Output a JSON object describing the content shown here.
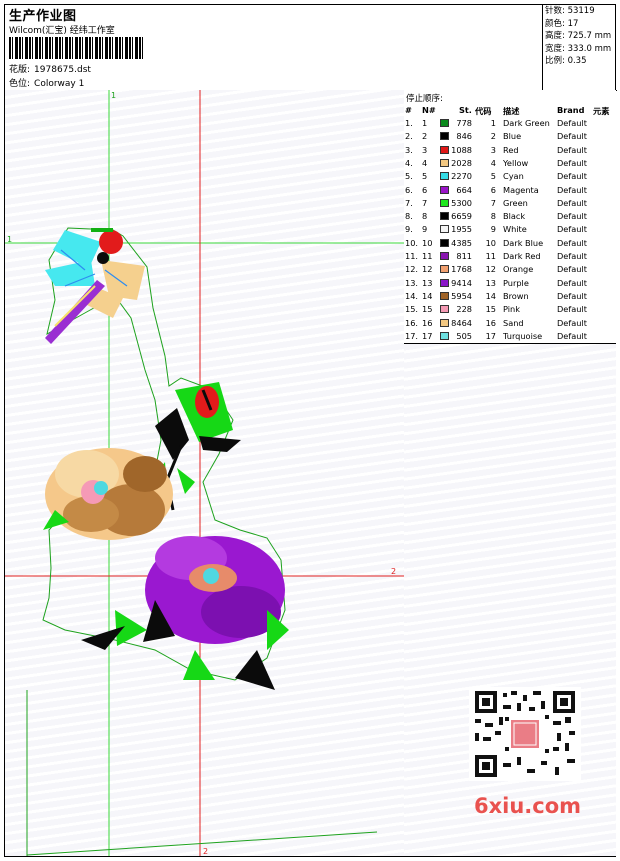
{
  "header": {
    "title": "生产作业图",
    "subtitle": "Wilcom(汇宝) 经纬工作室",
    "design_label": "花版:",
    "design_value": "1978675.dst",
    "colorway_label": "色位:",
    "colorway_value": "Colorway 1"
  },
  "stats": {
    "stitches": "针数: 53119",
    "colors": "颜色: 17",
    "height": "高度: 725.7 mm",
    "width": "宽度: 333.0 mm",
    "scale": "比例: 0.35"
  },
  "canvas": {
    "guide_v1": "1",
    "guide_h1": "1",
    "guide_v2": "2",
    "guide_h2": "2"
  },
  "table": {
    "caption": "停止顺序:",
    "headers": [
      "#",
      "N#",
      "St.",
      "代码",
      "描述",
      "Brand",
      "元素"
    ],
    "rows": [
      {
        "i": "1.",
        "n": "1",
        "color": "#0a8a1c",
        "st": "778",
        "code": "1",
        "desc": "Dark Green",
        "brand": "Default"
      },
      {
        "i": "2.",
        "n": "2",
        "color": "#000000",
        "st": "846",
        "code": "2",
        "desc": "Blue",
        "brand": "Default"
      },
      {
        "i": "3.",
        "n": "3",
        "color": "#e01818",
        "st": "1088",
        "code": "3",
        "desc": "Red",
        "brand": "Default"
      },
      {
        "i": "4.",
        "n": "4",
        "color": "#f3c882",
        "st": "2028",
        "code": "4",
        "desc": "Yellow",
        "brand": "Default"
      },
      {
        "i": "5.",
        "n": "5",
        "color": "#36dde6",
        "st": "2270",
        "code": "5",
        "desc": "Cyan",
        "brand": "Default"
      },
      {
        "i": "6.",
        "n": "6",
        "color": "#9a14c8",
        "st": "664",
        "code": "6",
        "desc": "Magenta",
        "brand": "Default"
      },
      {
        "i": "7.",
        "n": "7",
        "color": "#1ee81e",
        "st": "5300",
        "code": "7",
        "desc": "Green",
        "brand": "Default"
      },
      {
        "i": "8.",
        "n": "8",
        "color": "#000000",
        "st": "6659",
        "code": "8",
        "desc": "Black",
        "brand": "Default"
      },
      {
        "i": "9.",
        "n": "9",
        "color": "#f4f4f4",
        "st": "1955",
        "code": "9",
        "desc": "White",
        "brand": "Default"
      },
      {
        "i": "10.",
        "n": "10",
        "color": "#000000",
        "st": "4385",
        "code": "10",
        "desc": "Dark Blue",
        "brand": "Default"
      },
      {
        "i": "11.",
        "n": "11",
        "color": "#8a16b0",
        "st": "811",
        "code": "11",
        "desc": "Dark Red",
        "brand": "Default"
      },
      {
        "i": "12.",
        "n": "12",
        "color": "#f0a070",
        "st": "1768",
        "code": "12",
        "desc": "Orange",
        "brand": "Default"
      },
      {
        "i": "13.",
        "n": "13",
        "color": "#8a16c8",
        "st": "9414",
        "code": "13",
        "desc": "Purple",
        "brand": "Default"
      },
      {
        "i": "14.",
        "n": "14",
        "color": "#a06428",
        "st": "5954",
        "code": "14",
        "desc": "Brown",
        "brand": "Default"
      },
      {
        "i": "15.",
        "n": "15",
        "color": "#f49ab4",
        "st": "228",
        "code": "15",
        "desc": "Pink",
        "brand": "Default"
      },
      {
        "i": "16.",
        "n": "16",
        "color": "#f3c882",
        "st": "8464",
        "code": "16",
        "desc": "Sand",
        "brand": "Default"
      },
      {
        "i": "17.",
        "n": "17",
        "color": "#6ee0e0",
        "st": "505",
        "code": "17",
        "desc": "Turquoise",
        "brand": "Default"
      }
    ]
  },
  "watermark": {
    "logo_text": "6xiu.com"
  }
}
